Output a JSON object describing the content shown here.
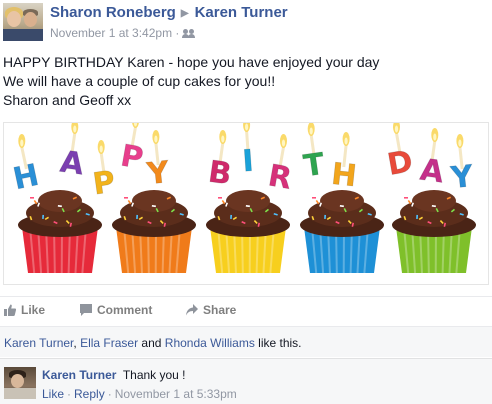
{
  "post": {
    "author": "Sharon Roneberg",
    "target": "Karen Turner",
    "timestamp": "November 1 at 3:42pm",
    "separator": "·",
    "audience_icon": "friends-icon",
    "lines": [
      "HAPPY BIRTHDAY Karen - hope you have enjoyed your day",
      "We will have a couple of cup cakes for you!!",
      "Sharon and Geoff xx"
    ]
  },
  "photo": {
    "letters": [
      "H",
      "A",
      "P",
      "P",
      "Y",
      "B",
      "I",
      "R",
      "T",
      "H",
      "D",
      "A",
      "Y"
    ],
    "letter_colors": [
      "#2a8fd6",
      "#7b3fb0",
      "#f2b31c",
      "#e83e8c",
      "#f28a1c",
      "#cf2a6b",
      "#1aa2d9",
      "#d6317a",
      "#2ea44f",
      "#f2a51c",
      "#e84a3a",
      "#c4308a",
      "#2a8fd6"
    ],
    "cup_colors": [
      "#e62a3a",
      "#f07b1a",
      "#f7cf1e",
      "#1e90d6",
      "#7fc02a"
    ]
  },
  "actions": {
    "like": "Like",
    "comment": "Comment",
    "share": "Share"
  },
  "likes": {
    "names": [
      "Karen Turner",
      "Ella Fraser",
      "Rhonda Williams"
    ],
    "comma": ",",
    "and": "and",
    "suffix": "like this."
  },
  "comment": {
    "author": "Karen Turner",
    "text": "Thank you !",
    "like": "Like",
    "reply": "Reply",
    "separator": "·",
    "timestamp": "November 1 at 5:33pm"
  },
  "colors": {
    "link": "#3b5998",
    "muted": "#9197a3",
    "text": "#141823"
  }
}
